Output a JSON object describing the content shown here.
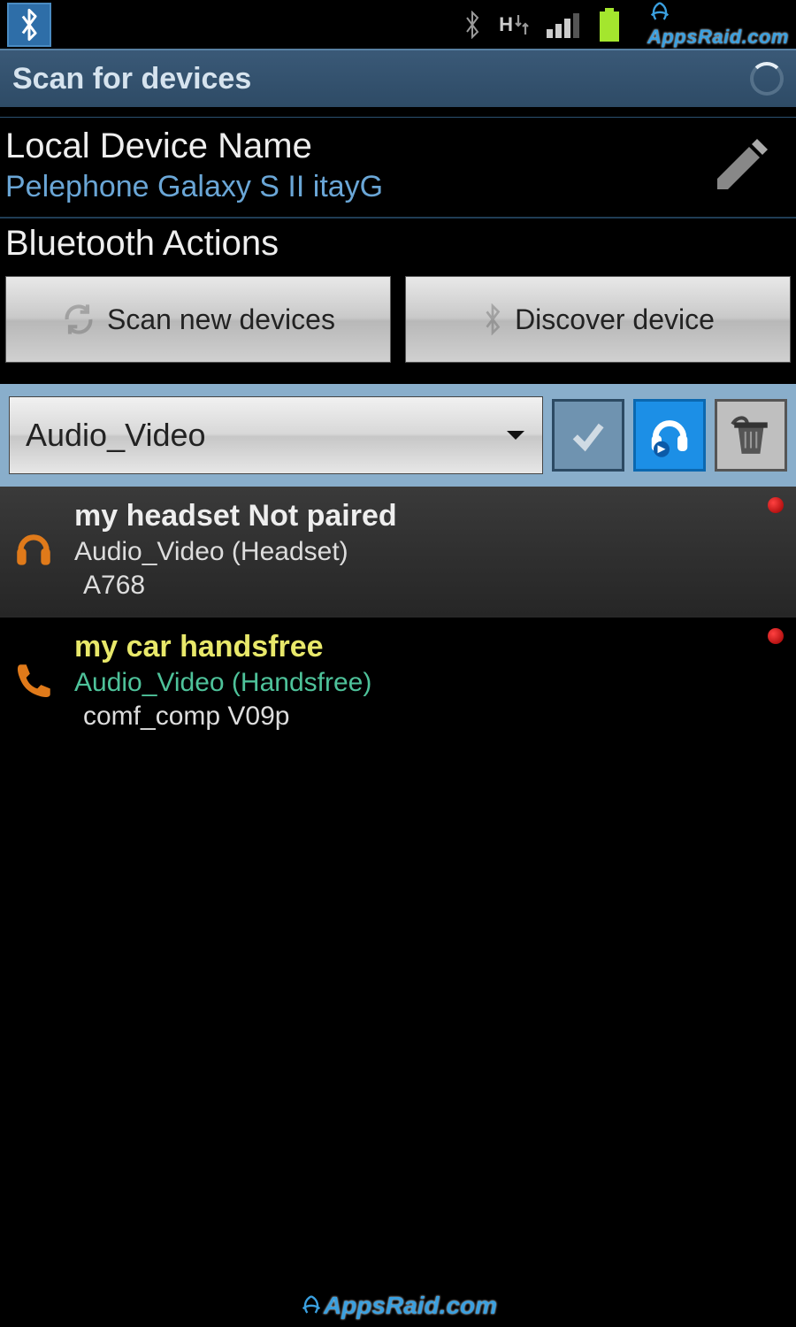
{
  "status": {
    "data_indicator": "H",
    "watermark": "AppsRaid.com"
  },
  "header": {
    "title": "Scan for devices"
  },
  "local_device": {
    "label": "Local Device Name",
    "value": "Pelephone Galaxy S II itayG"
  },
  "actions": {
    "label": "Bluetooth Actions",
    "scan_label": "Scan new devices",
    "discover_label": "Discover device"
  },
  "filter": {
    "selected": "Audio_Video"
  },
  "devices": [
    {
      "name": "my headset Not paired",
      "type": "Audio_Video (Headset)",
      "id": "A768",
      "name_color": "#eeeeee",
      "type_color": "#dddddd",
      "icon": "headset",
      "highlight": true
    },
    {
      "name": "my car handsfree",
      "type": "Audio_Video (Handsfree)",
      "id": "comf_comp V09p",
      "name_color": "#e8e86a",
      "type_color": "#4ec29a",
      "icon": "phone",
      "highlight": false
    }
  ],
  "footer": {
    "watermark": "AppsRaid.com"
  }
}
